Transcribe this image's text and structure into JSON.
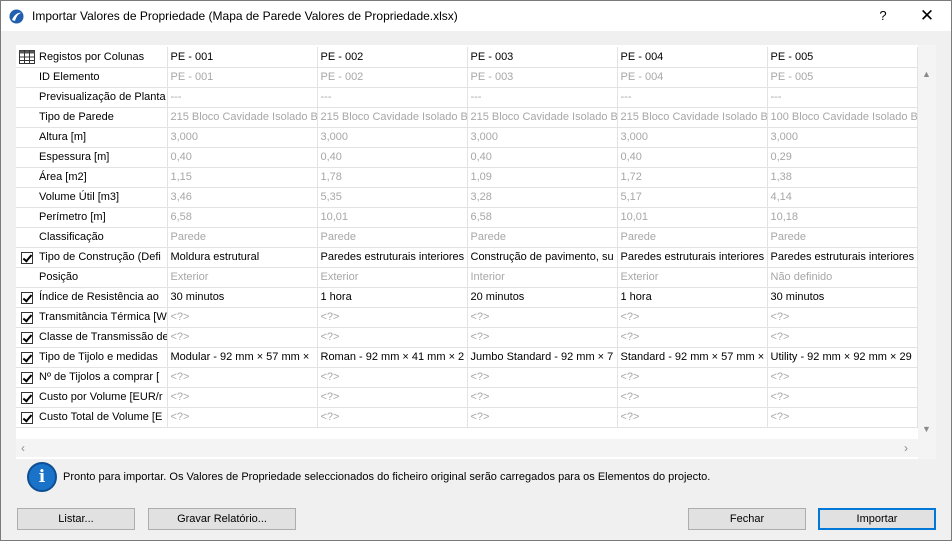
{
  "window": {
    "title": "Importar Valores de Propriedade (Mapa de Parede Valores de Propriedade.xlsx)",
    "help_label": "?",
    "close_label": "✕",
    "accent_color": "#0078d7"
  },
  "grid": {
    "header": {
      "label": "Registos por Colunas",
      "columns": [
        "PE - 001",
        "PE - 002",
        "PE - 003",
        "PE - 004",
        "PE - 005"
      ]
    },
    "rows": [
      {
        "label": "ID Elemento",
        "checked": false,
        "values": [
          "PE - 001",
          "PE - 002",
          "PE - 003",
          "PE - 004",
          "PE - 005"
        ]
      },
      {
        "label": "Previsualização de Planta",
        "checked": false,
        "values": [
          "---",
          "---",
          "---",
          "---",
          "---"
        ]
      },
      {
        "label": "Tipo de Parede",
        "checked": false,
        "values": [
          "215 Bloco Cavidade Isolado B",
          "215 Bloco Cavidade Isolado B",
          "215 Bloco Cavidade Isolado B",
          "215 Bloco Cavidade Isolado B",
          "100 Bloco Cavidade Isolado B"
        ]
      },
      {
        "label": "Altura [m]",
        "checked": false,
        "values": [
          "3,000",
          "3,000",
          "3,000",
          "3,000",
          "3,000"
        ]
      },
      {
        "label": "Espessura [m]",
        "checked": false,
        "values": [
          "0,40",
          "0,40",
          "0,40",
          "0,40",
          "0,29"
        ]
      },
      {
        "label": "Área [m2]",
        "checked": false,
        "values": [
          "1,15",
          "1,78",
          "1,09",
          "1,72",
          "1,38"
        ]
      },
      {
        "label": "Volume Útil [m3]",
        "checked": false,
        "values": [
          "3,46",
          "5,35",
          "3,28",
          "5,17",
          "4,14"
        ]
      },
      {
        "label": "Perímetro [m]",
        "checked": false,
        "values": [
          "6,58",
          "10,01",
          "6,58",
          "10,01",
          "10,18"
        ]
      },
      {
        "label": "Classificação",
        "checked": false,
        "values": [
          "Parede",
          "Parede",
          "Parede",
          "Parede",
          "Parede"
        ]
      },
      {
        "label": "Tipo de Construção (Defi",
        "checked": true,
        "values": [
          "Moldura estrutural",
          "Paredes estruturais interiores",
          "Construção de pavimento, su",
          "Paredes estruturais interiores",
          "Paredes estruturais interiores"
        ]
      },
      {
        "label": "Posição",
        "checked": false,
        "values": [
          "Exterior",
          "Exterior",
          "Interior",
          "Exterior",
          "Não definido"
        ]
      },
      {
        "label": "Índice de Resistência ao",
        "checked": true,
        "values": [
          "30 minutos",
          "1 hora",
          "20 minutos",
          "1 hora",
          "30 minutos"
        ]
      },
      {
        "label": "Transmitância Térmica [W",
        "checked": true,
        "values": [
          "<?>",
          "<?>",
          "<?>",
          "<?>",
          "<?>"
        ]
      },
      {
        "label": "Classe de Transmissão de",
        "checked": true,
        "values": [
          "<?>",
          "<?>",
          "<?>",
          "<?>",
          "<?>"
        ]
      },
      {
        "label": " Tipo de Tijolo e medidas",
        "checked": true,
        "values": [
          "Modular - 92 mm × 57 mm ×",
          "Roman - 92 mm × 41 mm × 2",
          "Jumbo Standard - 92 mm × 7",
          "Standard - 92 mm × 57 mm ×",
          "Utility - 92 mm × 92 mm × 29"
        ]
      },
      {
        "label": "Nº de Tijolos a comprar [",
        "checked": true,
        "values": [
          "<?>",
          "<?>",
          "<?>",
          "<?>",
          "<?>"
        ]
      },
      {
        "label": "Custo por Volume [EUR/r",
        "checked": true,
        "values": [
          "<?>",
          "<?>",
          "<?>",
          "<?>",
          "<?>"
        ]
      },
      {
        "label": "Custo Total de Volume [E",
        "checked": true,
        "values": [
          "<?>",
          "<?>",
          "<?>",
          "<?>",
          "<?>"
        ]
      }
    ]
  },
  "status": {
    "icon": "info-icon",
    "text": "Pronto para importar. Os Valores de Propriedade seleccionados do ficheiro original serão carregados para os Elementos do projecto."
  },
  "buttons": {
    "list": "Listar...",
    "save_report": "Gravar Relatório...",
    "close": "Fechar",
    "import": "Importar"
  }
}
